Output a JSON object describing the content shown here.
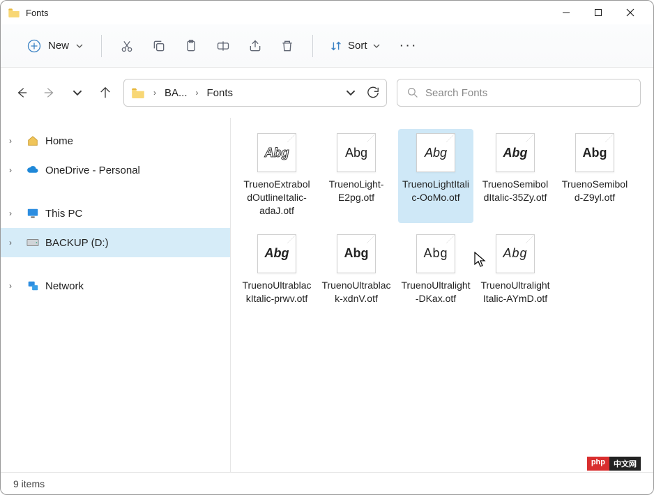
{
  "window": {
    "title": "Fonts"
  },
  "toolbar": {
    "new": "New",
    "sort": "Sort"
  },
  "breadcrumb": {
    "seg1": "BA...",
    "seg2": "Fonts"
  },
  "search": {
    "placeholder": "Search Fonts"
  },
  "sidebar": {
    "home": "Home",
    "onedrive": "OneDrive - Personal",
    "thispc": "This PC",
    "backup": "BACKUP (D:)",
    "network": "Network"
  },
  "files": [
    {
      "name": "TruenoExtraboldOutlineItalic-adaJ.otf",
      "thumb_class": "outline"
    },
    {
      "name": "TruenoLight-E2pg.otf",
      "thumb_class": "light"
    },
    {
      "name": "TruenoLightItalic-OoMo.otf",
      "thumb_class": "lightitalic",
      "selected": true
    },
    {
      "name": "TruenoSemiboldItalic-35Zy.otf",
      "thumb_class": "semibolditalic"
    },
    {
      "name": "TruenoSemibold-Z9yl.otf",
      "thumb_class": "semibold"
    },
    {
      "name": "TruenoUltrablackItalic-prwv.otf",
      "thumb_class": "ultrablackitalic"
    },
    {
      "name": "TruenoUltrablack-xdnV.otf",
      "thumb_class": "ultrablack"
    },
    {
      "name": "TruenoUltralight-DKax.otf",
      "thumb_class": "ultralight"
    },
    {
      "name": "TruenoUltralightItalic-AYmD.otf",
      "thumb_class": "ultralightitalic"
    }
  ],
  "thumb_text": "Abg",
  "status": {
    "count": "9 items"
  },
  "brand": {
    "left": "php",
    "right": "中文网"
  }
}
